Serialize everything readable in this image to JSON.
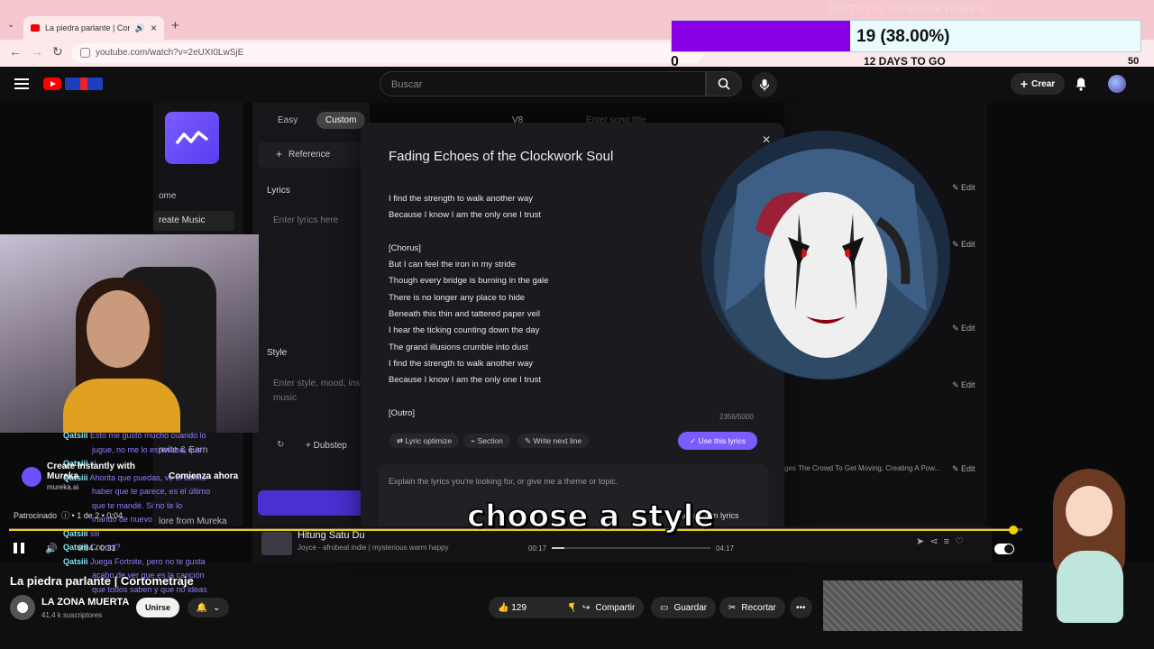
{
  "browser": {
    "tab_title": "La piedra parlante | Corton",
    "url": "youtube.com/watch?v=2eUXI0LwSjE"
  },
  "goal": {
    "title": "META DE SUSCRIPTORES",
    "value": "19 (38.00%)",
    "progress": 0.38,
    "min": "0",
    "max": "50",
    "days": "12 DAYS TO GO"
  },
  "header": {
    "search_placeholder": "Buscar",
    "create_label": "Crear"
  },
  "mureka": {
    "tabs": [
      "Easy",
      "Custom"
    ],
    "version": "V8",
    "reference": "Reference",
    "lyrics_label": "Lyrics",
    "lyrics_placeholder": "Enter lyrics here",
    "style_label": "Style",
    "style_placeholder": "Enter style, mood, inst",
    "style_placeholder2": "music",
    "dubstep": "Dubstep",
    "menu_home": "ome",
    "menu_create": "reate Music",
    "menu_invite": "nvite & Earn",
    "menu_more": "lore from Mureka",
    "song_search_placeholder": "Enter song title",
    "edit_label": "Edit",
    "crowd_text": "ges The Crowd To Get Moving, Creating A Pow..."
  },
  "modal": {
    "title": "Fading Echoes of the Clockwork Soul",
    "lyrics": [
      "I find the strength to walk another way",
      "Because I know I am the only one I trust",
      "",
      "[Chorus]",
      "But I can feel the iron in my stride",
      "Though every bridge is burning in the gale",
      "There is no longer any place to hide",
      "Beneath this thin and tattered paper veil",
      "I hear the ticking counting down the day",
      "The grand illusions crumble into dust",
      "I find the strength to walk another way",
      "Because I know I am the only one I trust",
      "",
      "[Outro]"
    ],
    "counter": "2356/5000",
    "btn_optimize": "Lyric optimize",
    "btn_section": "Section",
    "btn_next": "Write next line",
    "btn_use": "Use this lyrics",
    "prompt_placeholder": "Explain the lyrics you're looking for, or give me a theme or topic.",
    "random_lyrics": "te random lyrics"
  },
  "song": {
    "title": "Hitung Satu Du",
    "meta": "Joyce - afrobeat indie | mysterious warm happy",
    "time_current": "00:17",
    "time_total": "04:17"
  },
  "player": {
    "subtitle": "choose a style",
    "time": "0:04 / 0:31",
    "progress": 0.99
  },
  "chat": [
    {
      "user": "Qatsiii",
      "msg": "Esto me gustó mucho cuando lo"
    },
    {
      "user": "",
      "msg": "jugue, no me lo esperaba, que"
    },
    {
      "user": "Qatsiii",
      "msg": "si"
    },
    {
      "user": "Qatsiii",
      "msg": "Ahorita que puedas, ve el corrito"
    },
    {
      "user": "",
      "msg": "haber que te parece, es el último"
    },
    {
      "user": "",
      "msg": "que te mandé. Si no te lo"
    },
    {
      "user": "",
      "msg": "mando de nuevo"
    },
    {
      "user": "Qatsiii",
      "msg": "siii"
    },
    {
      "user": "Qatsiii",
      "msg": "Cooool?"
    },
    {
      "user": "Qatsiii",
      "msg": "Juega Fortnite, pero no te gusta"
    },
    {
      "user": "",
      "msg": "acabo de ver que es la canción"
    },
    {
      "user": "",
      "msg": "que todos saben y que no ideas"
    }
  ],
  "ad": {
    "title": "Create Instantly with",
    "title2": "Mureka",
    "brand": "mureka.ai",
    "cta": "Comienza ahora",
    "sponsored": "Patrocinado",
    "count": "1 de 2",
    "time": "0:04"
  },
  "video": {
    "title": "La piedra parlante | Cortometraje"
  },
  "channel": {
    "name": "LA ZONA MUERTA",
    "subs": "41.4 k suscriptores",
    "join": "Unirse"
  },
  "actions": {
    "likes": "129",
    "share": "Compartir",
    "save": "Guardar",
    "clip": "Recortar"
  },
  "colors": {
    "goal_fill": "#8a00e6",
    "accent": "#7a5cff",
    "progress": "#f5d000"
  }
}
